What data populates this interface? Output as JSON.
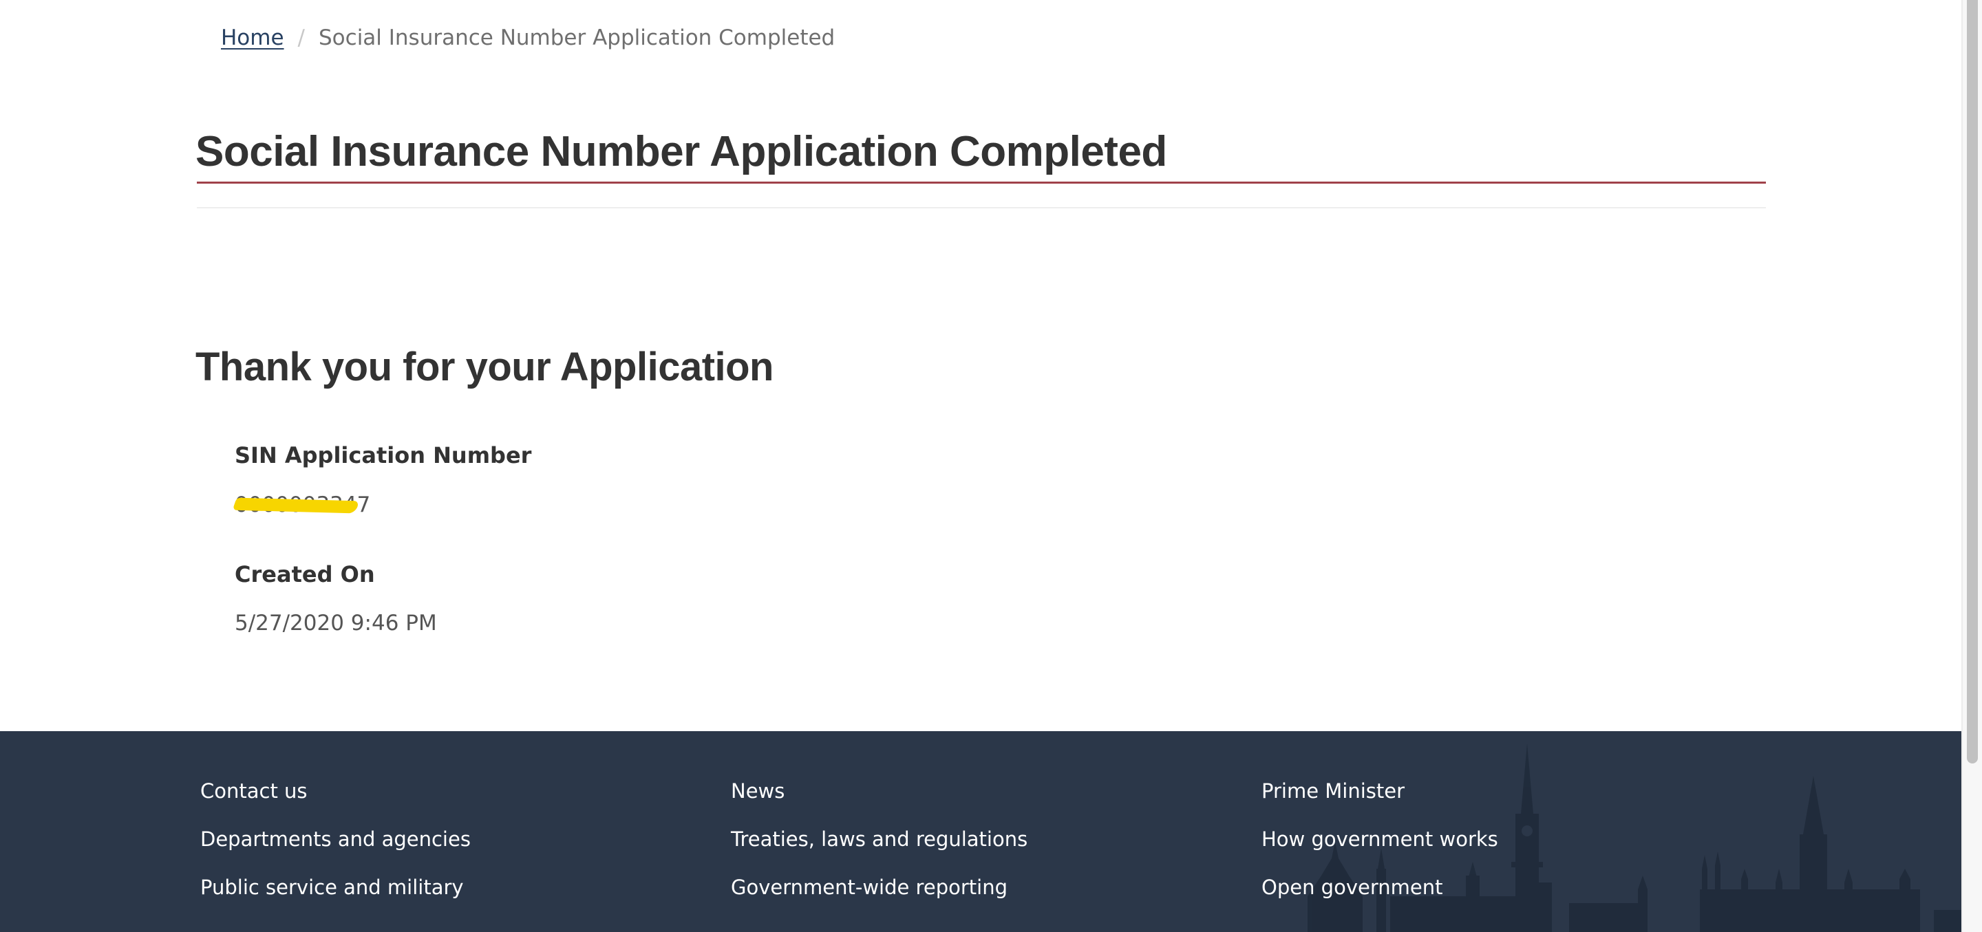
{
  "breadcrumb": {
    "home_label": "Home",
    "separator": "/",
    "current_label": "Social Insurance Number Application Completed"
  },
  "page_title": "Social Insurance Number Application Completed",
  "confirmation": {
    "heading": "Thank you for your Application",
    "sin_application_number_label": "SIN Application Number",
    "sin_application_number_value": "0000003347",
    "sin_application_number_redacted": true,
    "created_on_label": "Created On",
    "created_on_value": "5/27/2020 9:46 PM"
  },
  "footer": {
    "columns": [
      {
        "links": [
          "Contact us",
          "Departments and agencies",
          "Public service and military"
        ]
      },
      {
        "links": [
          "News",
          "Treaties, laws and regulations",
          "Government-wide reporting"
        ]
      },
      {
        "links": [
          "Prime Minister",
          "How government works",
          "Open government"
        ]
      }
    ],
    "background_icon": "parliament-skyline-icon"
  },
  "colors": {
    "link": "#284162",
    "title_rule": "#a0424a",
    "footer_bg": "#2b3749",
    "redaction": "#f7d500"
  }
}
